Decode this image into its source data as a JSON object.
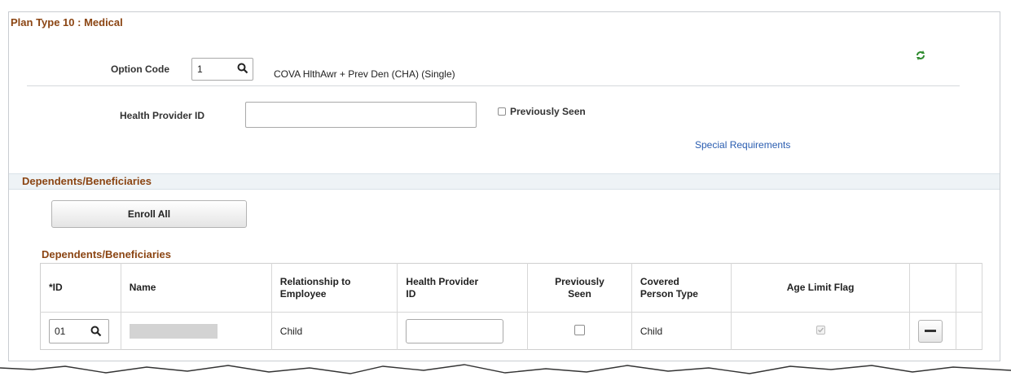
{
  "plan": {
    "title": "Plan Type 10 : Medical",
    "option_code_label": "Option Code",
    "option_code_value": "1",
    "option_description": "COVA HlthAwr + Prev Den (CHA) (Single)",
    "health_provider_label": "Health Provider ID",
    "health_provider_value": "",
    "previously_seen_label": "Previously Seen",
    "special_requirements_link": "Special Requirements"
  },
  "dependents": {
    "section_title": "Dependents/Beneficiaries",
    "enroll_all_label": "Enroll All",
    "grid_title": "Dependents/Beneficiaries",
    "columns": {
      "id": "*ID",
      "name": "Name",
      "relationship_1": "Relationship to",
      "relationship_2": "Employee",
      "hpid_1": "Health Provider",
      "hpid_2": "ID",
      "prev_1": "Previously",
      "prev_2": "Seen",
      "cpt_1": "Covered",
      "cpt_2": "Person Type",
      "age_limit": "Age Limit Flag"
    },
    "rows": [
      {
        "id": "01",
        "name": "",
        "relationship": "Child",
        "health_provider_id": "",
        "covered_person_type": "Child"
      }
    ]
  },
  "colors": {
    "section_title": "#8b4513",
    "link": "#2a5db0",
    "refresh_icon": "#2e8b2e"
  }
}
